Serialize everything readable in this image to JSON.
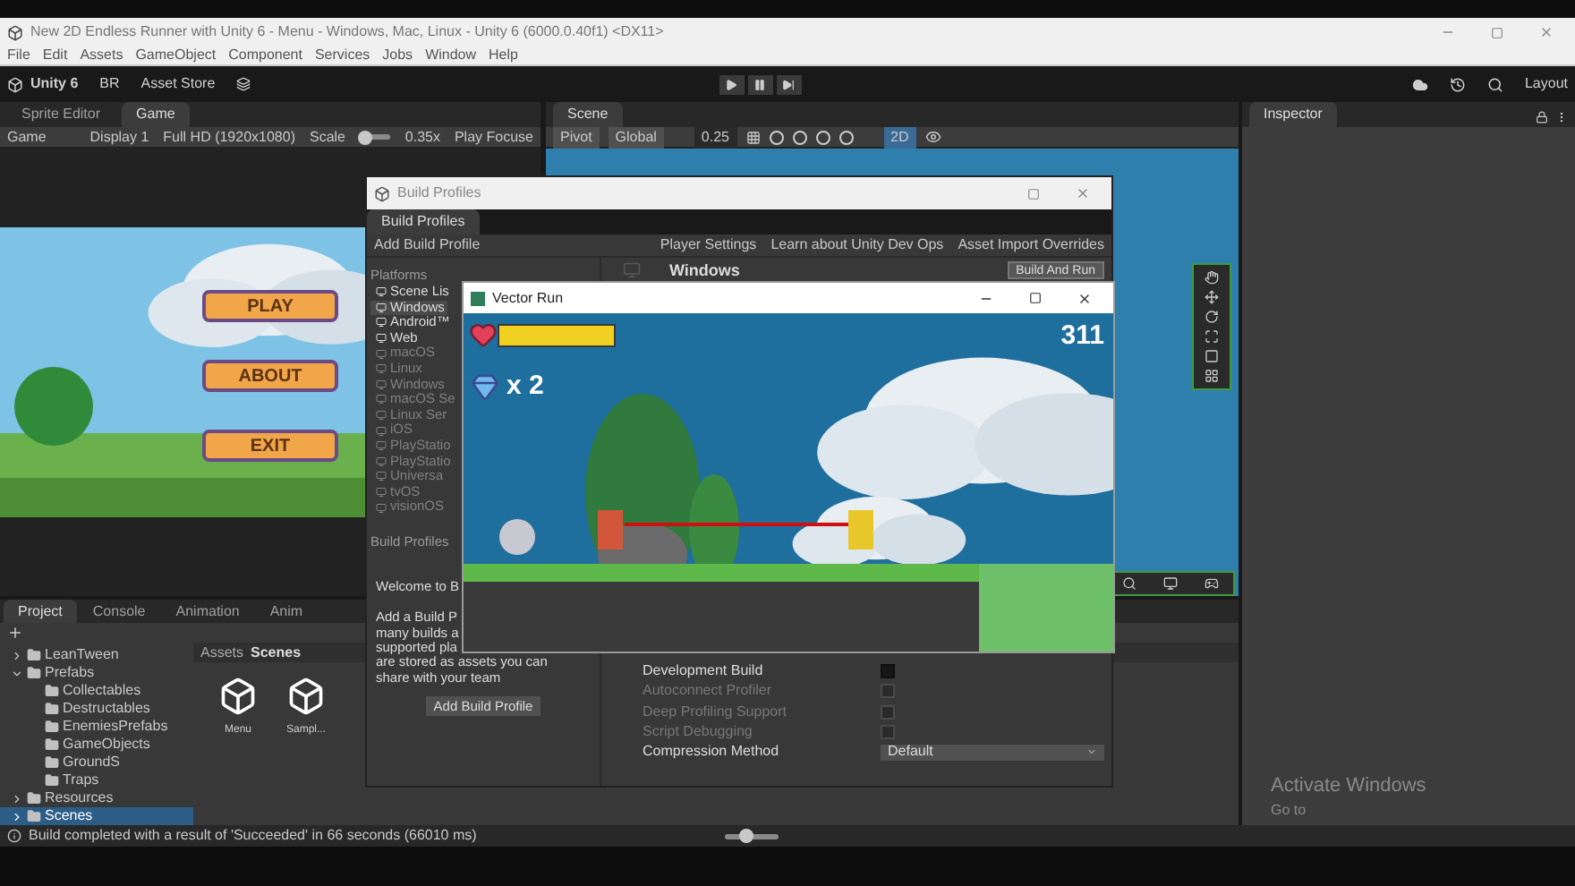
{
  "window": {
    "title": "New 2D Endless Runner with Unity 6 - Menu - Windows, Mac, Linux - Unity 6 (6000.0.40f1) <DX11>"
  },
  "menu_bar": [
    "File",
    "Edit",
    "Assets",
    "GameObject",
    "Component",
    "Services",
    "Jobs",
    "Window",
    "Help"
  ],
  "toolbar": {
    "account": "Unity 6",
    "user": "BR",
    "asset_store": "Asset Store",
    "layout": "Layout"
  },
  "game_panel": {
    "tabs": [
      {
        "label": "Sprite Editor",
        "selected": false
      },
      {
        "label": "Game",
        "selected": true
      }
    ],
    "view_mode": "Game",
    "display": "Display 1",
    "resolution": "Full HD (1920x1080)",
    "scale_label": "Scale",
    "scale": {
      "level": 0.15
    },
    "scale_value": "0.35x",
    "play_mode": "Play Focuse",
    "menu_buttons": [
      "PLAY",
      "ABOUT",
      "EXIT"
    ]
  },
  "scene_panel": {
    "tab": {
      "label": "Scene",
      "selected": true
    },
    "pivot": "Pivot",
    "space": "Global",
    "snap": "0.25",
    "mode_2d": {
      "label": "2D",
      "on": true
    }
  },
  "inspector": {
    "tab": {
      "label": "Inspector",
      "selected": true
    }
  },
  "project_panel": {
    "tabs": [
      {
        "label": "Project",
        "selected": true
      },
      {
        "label": "Console",
        "selected": false
      },
      {
        "label": "Animation",
        "selected": false
      },
      {
        "label": "Anim",
        "selected": false
      }
    ],
    "tree": [
      {
        "label": "LeanTween",
        "expanded": false,
        "selected": false
      },
      {
        "label": "Prefabs",
        "expanded": true,
        "selected": false,
        "children": [
          {
            "label": "Collectables",
            "selected": false
          },
          {
            "label": "Destructables",
            "selected": false
          },
          {
            "label": "EnemiesPrefabs",
            "selected": false
          },
          {
            "label": "GameObjects",
            "selected": false
          },
          {
            "label": "GroundS",
            "selected": false
          },
          {
            "label": "Traps",
            "selected": false
          }
        ]
      },
      {
        "label": "Resources",
        "expanded": false,
        "selected": false
      },
      {
        "label": "Scenes",
        "expanded": false,
        "selected": true
      }
    ],
    "breadcrumb": [
      "Assets",
      "Scenes"
    ],
    "assets": [
      "Menu",
      "Sampl..."
    ],
    "zoom": {
      "level": 0.4
    }
  },
  "build_profiles": {
    "title": "Build Profiles",
    "tab": {
      "label": "Build Profiles",
      "selected": true
    },
    "add_button": "Add Build Profile",
    "links": [
      "Player Settings",
      "Learn about Unity Dev Ops",
      "Asset Import Overrides"
    ],
    "platforms_header": "Platforms",
    "platforms": [
      {
        "label": "Scene Lis",
        "selected": false,
        "disabled": false
      },
      {
        "label": "Windows",
        "selected": true,
        "disabled": false
      },
      {
        "label": "Android™",
        "selected": false,
        "disabled": false
      },
      {
        "label": "Web",
        "selected": false,
        "disabled": false
      },
      {
        "label": "macOS",
        "selected": false,
        "disabled": true
      },
      {
        "label": "Linux",
        "selected": false,
        "disabled": true
      },
      {
        "label": "Windows",
        "selected": false,
        "disabled": true
      },
      {
        "label": "macOS Se",
        "selected": false,
        "disabled": true
      },
      {
        "label": "Linux Ser",
        "selected": false,
        "disabled": true
      },
      {
        "label": "iOS",
        "selected": false,
        "disabled": true
      },
      {
        "label": "PlayStatio",
        "selected": false,
        "disabled": true
      },
      {
        "label": "PlayStatio",
        "selected": false,
        "disabled": true
      },
      {
        "label": "Universa",
        "selected": false,
        "disabled": true
      },
      {
        "label": "tvOS",
        "selected": false,
        "disabled": true
      },
      {
        "label": "visionOS",
        "selected": false,
        "disabled": true
      }
    ],
    "profiles_header": "Build Profiles",
    "welcome": "Welcome to B",
    "description_lines": [
      "Add a Build P",
      "many builds a",
      "supported pla",
      "are stored as assets you can",
      "share with your team"
    ],
    "add_profile_button": "Add Build Profile",
    "platform_title": "Windows",
    "build_and_run": "Build And Run",
    "settings": [
      {
        "kind": "checkbox",
        "label": "Development Build",
        "checked": false,
        "disabled": false
      },
      {
        "kind": "checkbox",
        "label": "Autoconnect Profiler",
        "checked": false,
        "disabled": true
      },
      {
        "kind": "checkbox",
        "label": "Deep Profiling Support",
        "checked": false,
        "disabled": true
      },
      {
        "kind": "checkbox",
        "label": "Script Debugging",
        "checked": false,
        "disabled": true
      },
      {
        "kind": "dropdown",
        "label": "Compression Method",
        "value": "Default",
        "disabled": false
      }
    ]
  },
  "game_window": {
    "title": "Vector Run",
    "health": {
      "level": 1
    },
    "gems": "x 2",
    "score": "311"
  },
  "status_bar": {
    "message": "Build completed with a result of 'Succeeded' in 66 seconds (66010 ms)"
  },
  "activation": {
    "title": "Activate Windows",
    "subtitle": "Go to"
  }
}
